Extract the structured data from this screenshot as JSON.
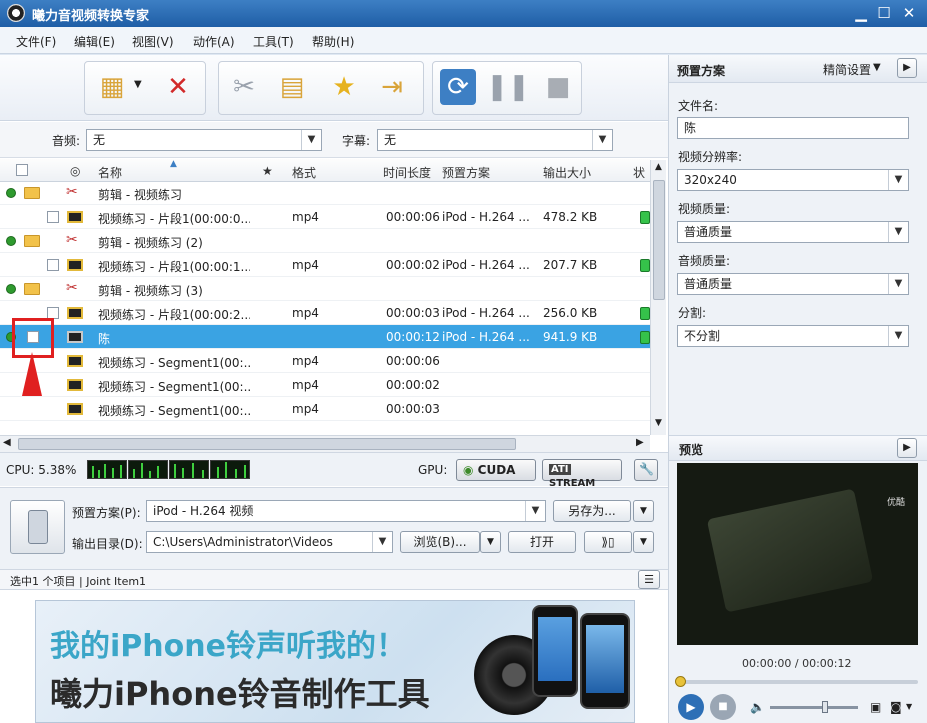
{
  "window": {
    "title": "曦力音视频转换专家"
  },
  "menu": [
    "文件(F)",
    "编辑(E)",
    "视图(V)",
    "动作(A)",
    "工具(T)",
    "帮助(H)"
  ],
  "filters": {
    "audio_label": "音频:",
    "audio_value": "无",
    "subtitle_label": "字幕:",
    "subtitle_value": "无"
  },
  "table": {
    "headers": [
      "名称",
      "★",
      "格式",
      "时间长度",
      "预置方案",
      "输出大小",
      "状"
    ],
    "rows": [
      {
        "type": "group",
        "name": "剪辑 - 视频练习"
      },
      {
        "type": "item",
        "name": "视频练习 - 片段1(00:00:0...",
        "format": "mp4",
        "duration": "00:00:06",
        "preset": "iPod - H.264 ...",
        "size": "478.2 KB"
      },
      {
        "type": "group",
        "name": "剪辑 - 视频练习 (2)"
      },
      {
        "type": "item",
        "name": "视频练习 - 片段1(00:00:1...",
        "format": "mp4",
        "duration": "00:00:02",
        "preset": "iPod - H.264 ...",
        "size": "207.7 KB"
      },
      {
        "type": "group",
        "name": "剪辑 - 视频练习 (3)"
      },
      {
        "type": "item",
        "name": "视频练习 - 片段1(00:00:2...",
        "format": "mp4",
        "duration": "00:00:03",
        "preset": "iPod - H.264 ...",
        "size": "256.0 KB"
      },
      {
        "type": "selected",
        "name": "陈",
        "format": "",
        "duration": "00:00:12",
        "preset": "iPod - H.264 ...",
        "size": "941.9 KB"
      },
      {
        "type": "segment",
        "name": "视频练习 - Segment1(00:...",
        "format": "mp4",
        "duration": "00:00:06"
      },
      {
        "type": "segment",
        "name": "视频练习 - Segment1(00:...",
        "format": "mp4",
        "duration": "00:00:02"
      },
      {
        "type": "segment",
        "name": "视频练习 - Segment1(00:...",
        "format": "mp4",
        "duration": "00:00:03"
      }
    ]
  },
  "cpu": {
    "label": "CPU: 5.38%",
    "gpu_label": "GPU:",
    "cuda": "CUDA",
    "stream": "STREAM"
  },
  "output": {
    "preset_label": "预置方案(P):",
    "preset_value": "iPod - H.264 视频",
    "save_as": "另存为...",
    "dir_label": "输出目录(D):",
    "dir_value": "C:\\Users\\Administrator\\Videos",
    "browse": "浏览(B)...",
    "open": "打开"
  },
  "status": {
    "text": "选中1 个项目 | Joint Item1"
  },
  "banner": {
    "line1": "我的iPhone铃声听我的！",
    "line2": "曦力iPhone铃音制作工具"
  },
  "right": {
    "header": "预置方案",
    "advanced": "精简设置",
    "filename_label": "文件名:",
    "filename_value": "陈",
    "resolution_label": "视频分辨率:",
    "resolution_value": "320x240",
    "vquality_label": "视频质量:",
    "vquality_value": "普通质量",
    "aquality_label": "音频质量:",
    "aquality_value": "普通质量",
    "split_label": "分割:",
    "split_value": "不分割",
    "preview_label": "预览",
    "watermark": "优酷",
    "time": "00:00:00 / 00:00:12"
  },
  "colors": {
    "titlebar": "#1f5ea6",
    "selection": "#3aa3e3",
    "annotation": "#e02020"
  }
}
